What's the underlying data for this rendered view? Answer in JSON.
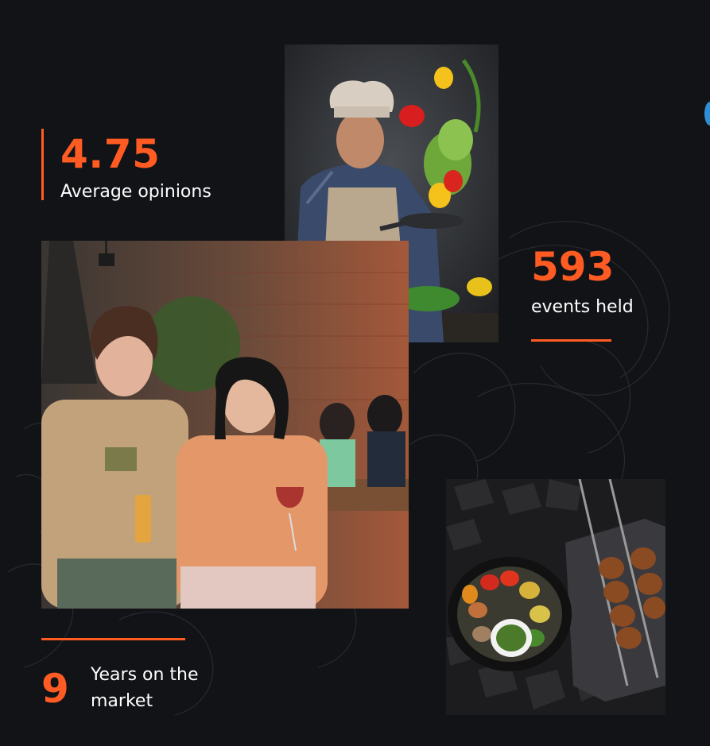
{
  "stats": {
    "opinions": {
      "value": "4.75",
      "label": "Average opinions"
    },
    "events": {
      "value": "593",
      "label": "events held"
    },
    "years": {
      "value": "9",
      "label": "Years on the market"
    }
  },
  "images": {
    "chef": {
      "alt": ""
    },
    "women": {
      "alt": ""
    },
    "grill": {
      "alt": ""
    }
  },
  "colors": {
    "background": "#111317",
    "accent": "#ff5b22",
    "text": "#ffffff"
  }
}
